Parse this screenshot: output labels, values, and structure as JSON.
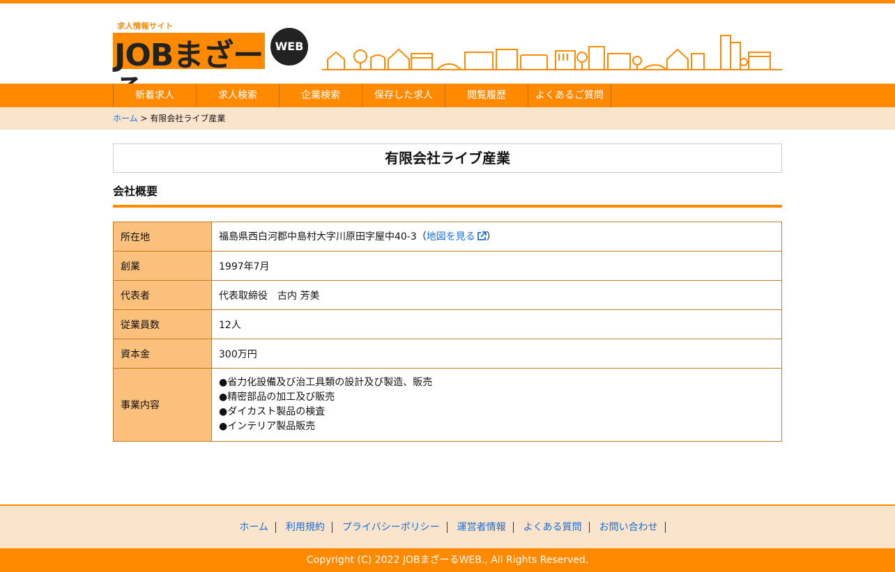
{
  "logo": {
    "tagline": "求人情報サイト",
    "main": "JOBまざーる",
    "badge": "WEB"
  },
  "nav": {
    "items": [
      {
        "label": "新着求人"
      },
      {
        "label": "求人検索"
      },
      {
        "label": "企業検索"
      },
      {
        "label": "保存した求人"
      },
      {
        "label": "閲覧履歴"
      },
      {
        "label": "よくあるご質問"
      }
    ]
  },
  "breadcrumb": {
    "home": "ホーム",
    "separator": ">",
    "current": "有限会社ライブ産業"
  },
  "company": {
    "name": "有限会社ライブ産業",
    "section_title": "会社概要",
    "rows": {
      "location": {
        "label": "所在地",
        "value": "福島県西白河郡中島村大字川原田字屋中40-3",
        "paren_open": "（",
        "map_link": "地図を見る",
        "paren_close": "）"
      },
      "founded": {
        "label": "創業",
        "value": "1997年7月"
      },
      "representative": {
        "label": "代表者",
        "value": "代表取締役　古内 芳美"
      },
      "employees": {
        "label": "従業員数",
        "value": "12人"
      },
      "capital": {
        "label": "資本金",
        "value": "300万円"
      },
      "business": {
        "label": "事業内容",
        "lines": [
          "●省力化設備及び治工具類の設計及び製造、販売",
          "●精密部品の加工及び販売",
          "●ダイカスト製品の検査",
          "●インテリア製品販売"
        ]
      }
    }
  },
  "footer": {
    "links": [
      {
        "label": "ホーム"
      },
      {
        "label": "利用規約"
      },
      {
        "label": "プライバシーポリシー"
      },
      {
        "label": "運営者情報"
      },
      {
        "label": "よくある質問"
      },
      {
        "label": "お問い合わせ"
      }
    ],
    "copyright": "Copyright (C) 2022 JOBまざーるWEB., All Rights Reserved."
  },
  "colors": {
    "accent": "#ff8a00",
    "light": "#fbe4cc",
    "th_bg": "#fbc07c",
    "link": "#1a6ed8"
  },
  "icons": {
    "map_link": "external-link-icon"
  }
}
